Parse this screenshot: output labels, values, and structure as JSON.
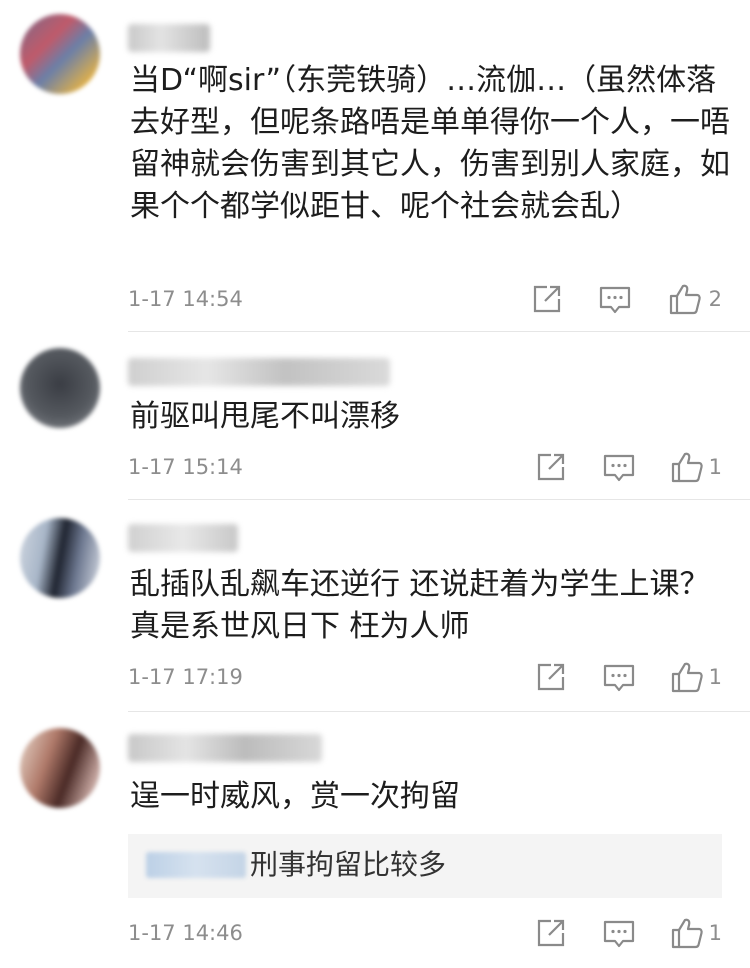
{
  "comments": [
    {
      "text": "当D“啊sir”（东莞铁骑）…流伽…（虽然体落去好型，但呢条路唔是单单得你一个人，一唔留神就会伤害到其它人，伤害到别人家庭，如果个个都学似距甘、呢个社会就会乱）",
      "time": "1-17 14:54",
      "likes": "2"
    },
    {
      "text": "前驱叫甩尾不叫漂移",
      "time": "1-17 15:14",
      "likes": "1"
    },
    {
      "text": "乱插队乱飙车还逆行 还说赶着为学生上课？真是系世风日下 枉为人师",
      "time": "1-17 17:19",
      "likes": "1"
    },
    {
      "text": "逞一时威风，赏一次拘留",
      "time": "1-17 14:46",
      "likes": "1",
      "reply": {
        "text": "刑事拘留比较多"
      }
    }
  ],
  "icons": {
    "share": "share-icon",
    "reply": "comment-icon",
    "like": "thumbs-up-icon"
  },
  "colors": {
    "text": "#1d1d1d",
    "meta": "#8d8d8d",
    "divider": "#e6e6e6",
    "reply_bg": "#f4f4f4"
  }
}
